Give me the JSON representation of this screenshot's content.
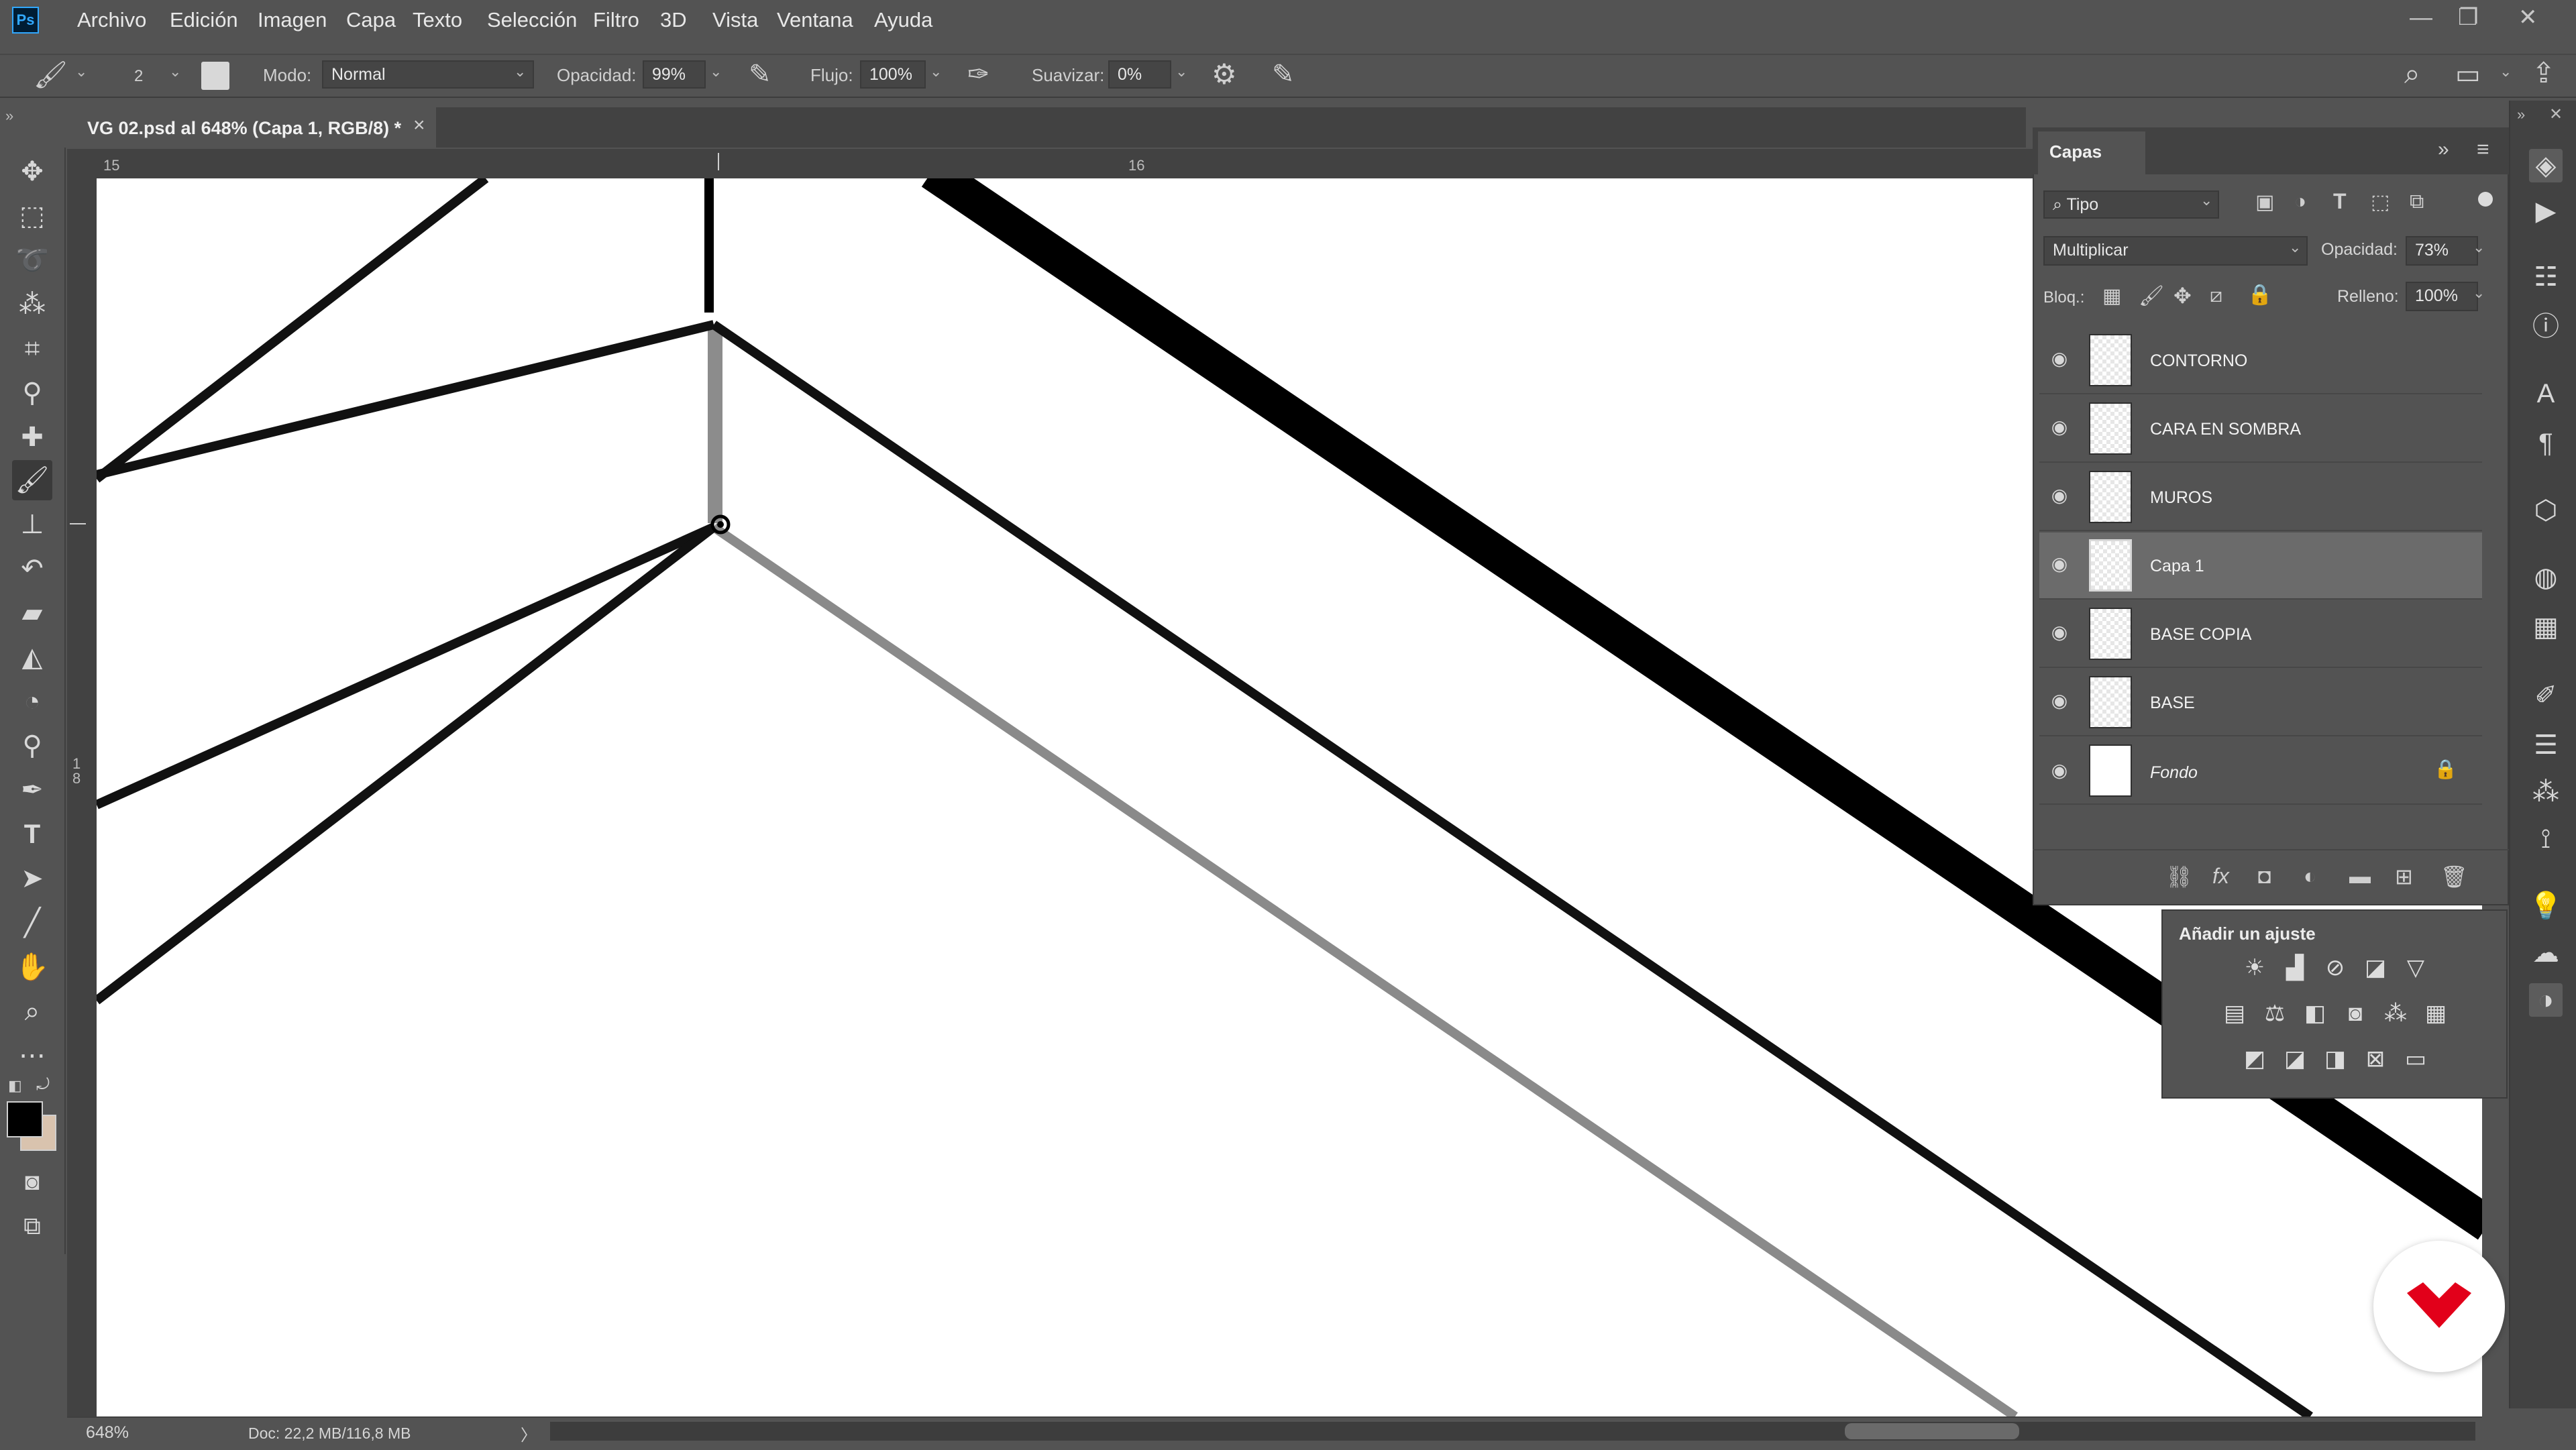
{
  "menu": {
    "logo": "Ps",
    "items": [
      "Archivo",
      "Edición",
      "Imagen",
      "Capa",
      "Texto",
      "Selección",
      "Filtro",
      "3D",
      "Vista",
      "Ventana",
      "Ayuda"
    ],
    "window_controls": [
      "—",
      "❐",
      "✕"
    ]
  },
  "options": {
    "brush_size": "2",
    "mode_label": "Modo:",
    "mode_value": "Normal",
    "opacity_label": "Opacidad:",
    "opacity_value": "99%",
    "flow_label": "Flujo:",
    "flow_value": "100%",
    "smoothing_label": "Suavizar:",
    "smoothing_value": "0%"
  },
  "document": {
    "tab_title": "VG 02.psd al 648% (Capa 1, RGB/8) *",
    "close": "×",
    "ruler_h": [
      "15",
      "16"
    ],
    "ruler_v": [
      "1",
      "8"
    ]
  },
  "status": {
    "zoom": "648%",
    "doc_info": "Doc: 22,2 MB/116,8 MB",
    "arrow": "〉"
  },
  "layers_panel": {
    "tab": "Capas",
    "filter_value": "Tipo",
    "blend_mode": "Multiplicar",
    "opacity_label": "Opacidad:",
    "opacity_value": "73%",
    "lock_label": "Bloq.:",
    "fill_label": "Relleno:",
    "fill_value": "100%",
    "layers": [
      {
        "name": "CONTORNO"
      },
      {
        "name": "CARA EN SOMBRA"
      },
      {
        "name": "MUROS"
      },
      {
        "name": "Capa 1"
      },
      {
        "name": "BASE COPIA"
      },
      {
        "name": "BASE"
      },
      {
        "name": "Fondo"
      }
    ]
  },
  "adjustments": {
    "title": "Añadir un ajuste"
  },
  "colors": {
    "ui_bg": "#535353",
    "panel_dark": "#424242",
    "canvas": "#ffffff",
    "accent": "#31a8ff",
    "logo_red": "#e2001a"
  }
}
